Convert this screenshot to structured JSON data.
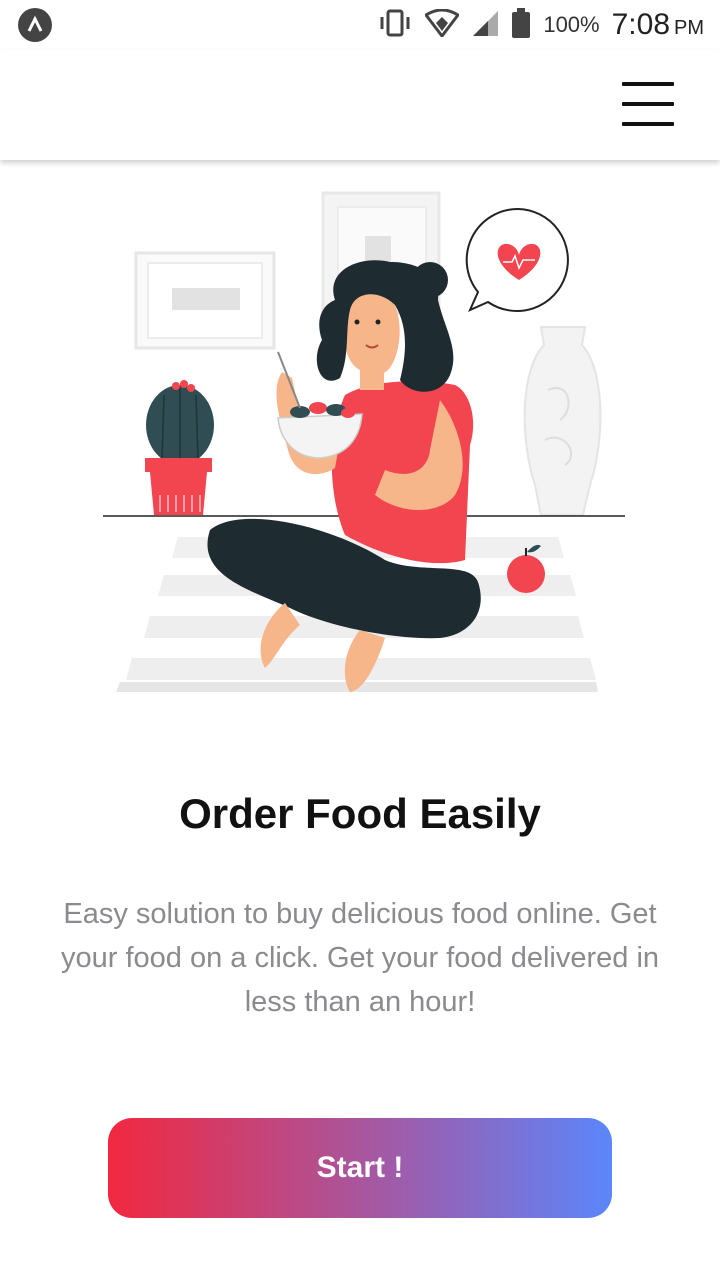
{
  "status_bar": {
    "battery_percent": "100%",
    "time": "7:08",
    "time_suffix": "PM"
  },
  "onboarding": {
    "title": "Order Food Easily",
    "description": "Easy solution to buy delicious food online. Get your food on a click.  Get your food delivered in less than an hour!",
    "start_button": "Start !"
  },
  "colors": {
    "accent_red": "#f2283f",
    "accent_blue": "#5b86fb",
    "text_gray": "#8a8a8f"
  }
}
